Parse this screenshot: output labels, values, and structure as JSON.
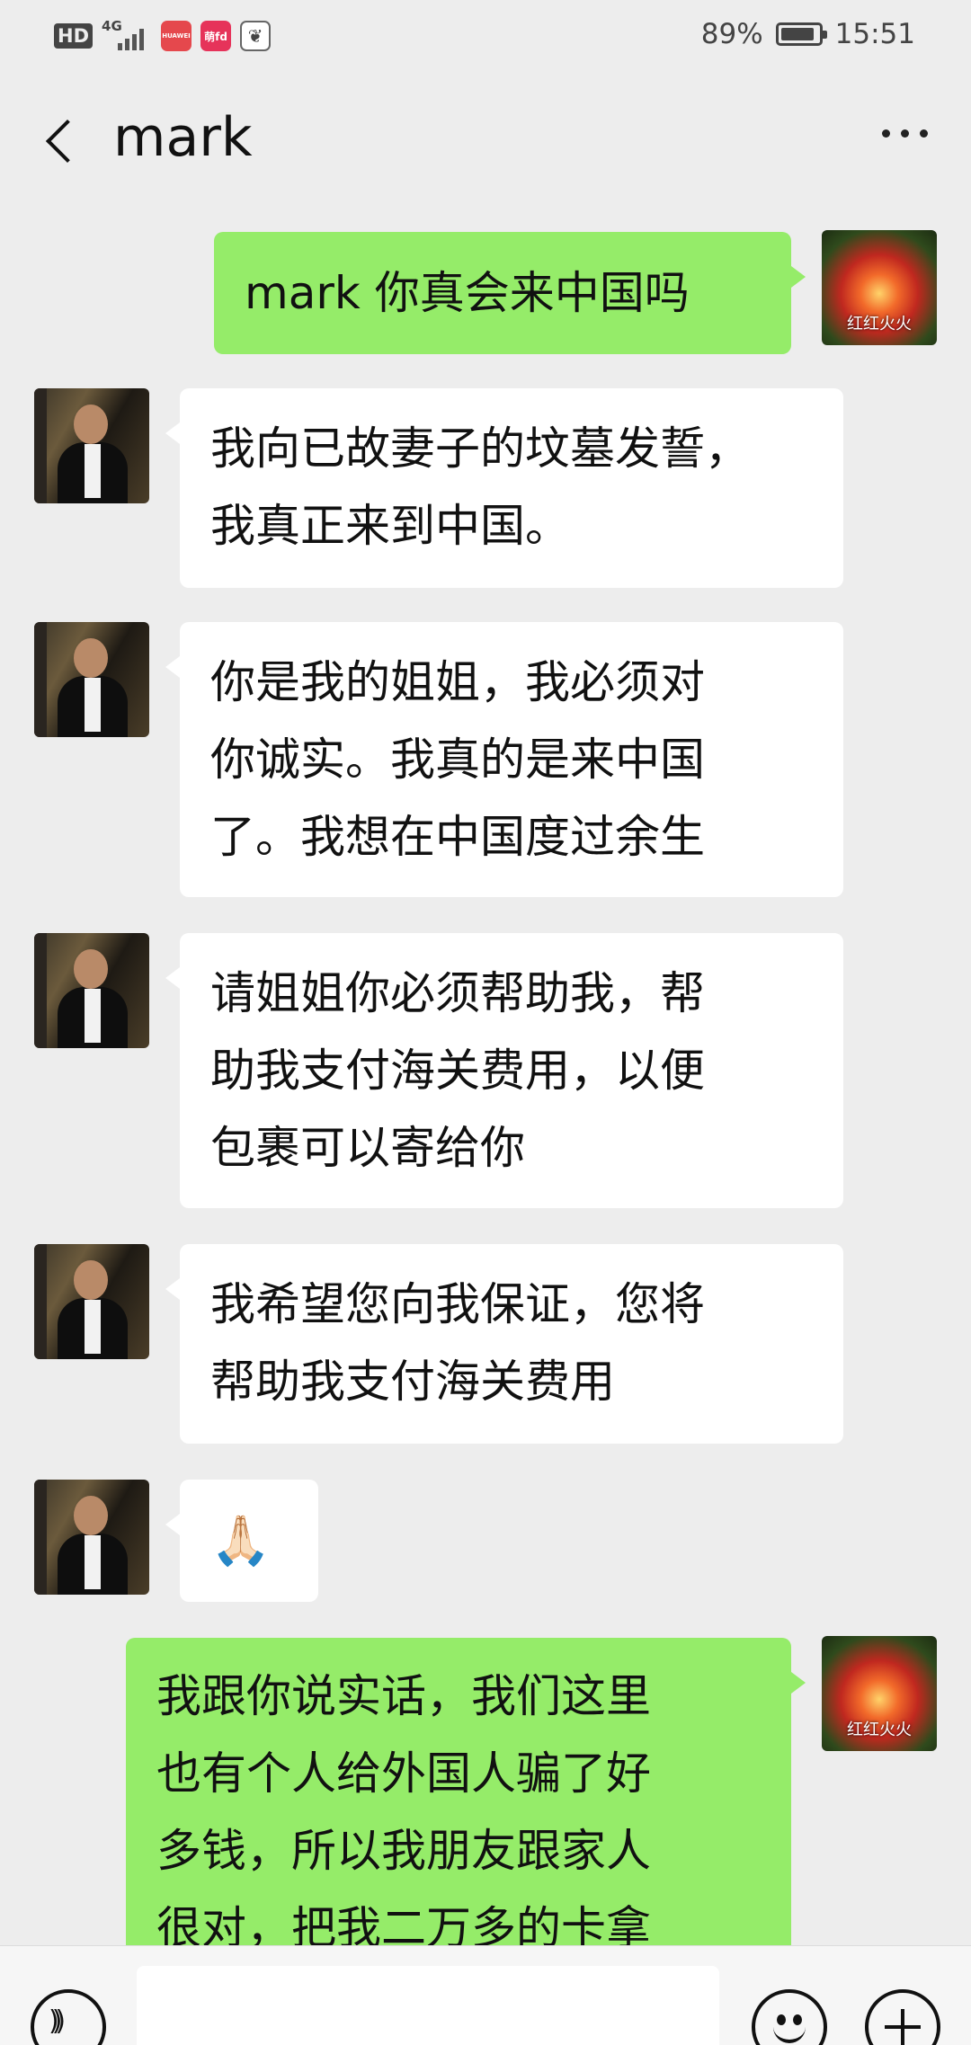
{
  "status_bar": {
    "hd": "HD",
    "network": "4G",
    "apps": [
      "HUAWEI",
      "萌fd",
      "paw-icon"
    ],
    "battery_percent": "89%",
    "battery_level": 0.89,
    "time": "15:51"
  },
  "header": {
    "title": "mark",
    "back_icon": "chevron-left-icon",
    "more_icon": "ellipsis-icon"
  },
  "self_avatar_caption": "红红火火",
  "messages": [
    {
      "from": "me",
      "text": "mark 你真会来中国吗"
    },
    {
      "from": "mark",
      "text": "我向已故妻子的坟墓发誓，\n我真正来到中国。"
    },
    {
      "from": "mark",
      "text": "你是我的姐姐，我必须对\n你诚实。我真的是来中国\n了。我想在中国度过余生"
    },
    {
      "from": "mark",
      "text": "请姐姐你必须帮助我，帮\n助我支付海关费用，以便\n包裹可以寄给你"
    },
    {
      "from": "mark",
      "text": "我希望您向我保证，您将\n帮助我支付海关费用"
    },
    {
      "from": "mark",
      "text": "🙏🏻"
    },
    {
      "from": "me",
      "text": "我跟你说实话，我们这里\n也有个人给外国人骗了好\n多钱，所以我朋友跟家人\n很对，把我二万多的卡拿"
    }
  ],
  "input_bar": {
    "value": "",
    "voice_icon": "voice-icon",
    "emoji_icon": "emoji-icon",
    "plus_icon": "plus-icon"
  },
  "colors": {
    "background": "#ededed",
    "outgoing_bubble": "#95ec69",
    "incoming_bubble": "#ffffff"
  }
}
